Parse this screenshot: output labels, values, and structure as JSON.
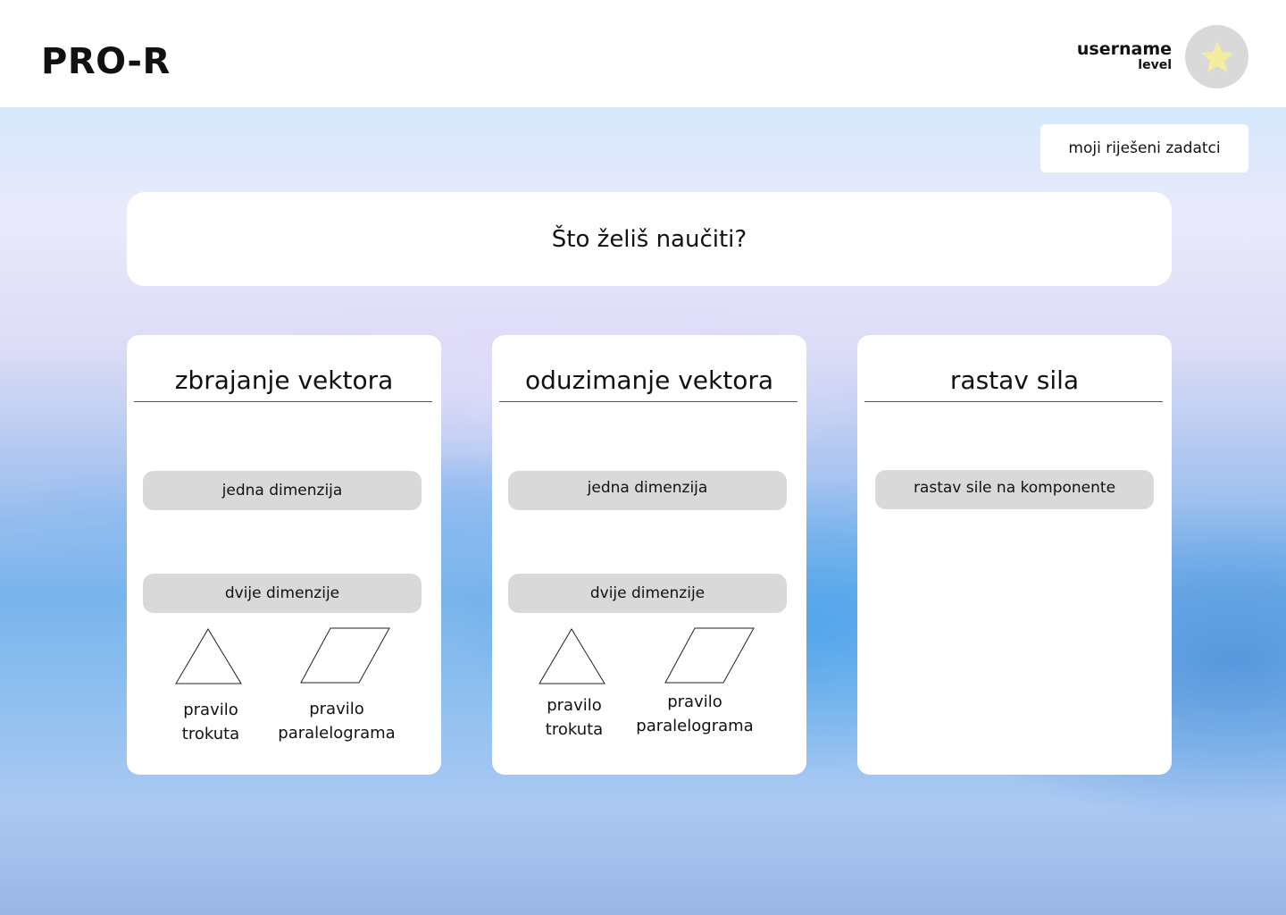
{
  "header": {
    "brand": "PRO-R",
    "username": "username",
    "level": "level",
    "avatar_icon": "star-icon",
    "star_color": "#f4eda0"
  },
  "solved_button": {
    "label": "moji riješeni zadatci"
  },
  "search": {
    "placeholder": "Što želiš naučiti?"
  },
  "cards": [
    {
      "title": "zbrajanje vektora",
      "options": [
        "jedna dimenzija",
        "dvije dimenzije"
      ],
      "shapes": [
        {
          "icon": "triangle-icon",
          "label_line1": "pravilo",
          "label_line2": "trokuta"
        },
        {
          "icon": "parallelogram-icon",
          "label_line1": "pravilo",
          "label_line2": "paralelograma"
        }
      ]
    },
    {
      "title": "oduzimanje vektora",
      "options": [
        "jedna dimenzija",
        "dvije dimenzije"
      ],
      "shapes": [
        {
          "icon": "triangle-icon",
          "label_line1": "pravilo",
          "label_line2": "trokuta"
        },
        {
          "icon": "parallelogram-icon",
          "label_line1": "pravilo",
          "label_line2": "paralelograma"
        }
      ]
    },
    {
      "title": "rastav sila",
      "options": [
        "rastav sile na komponente"
      ]
    }
  ]
}
